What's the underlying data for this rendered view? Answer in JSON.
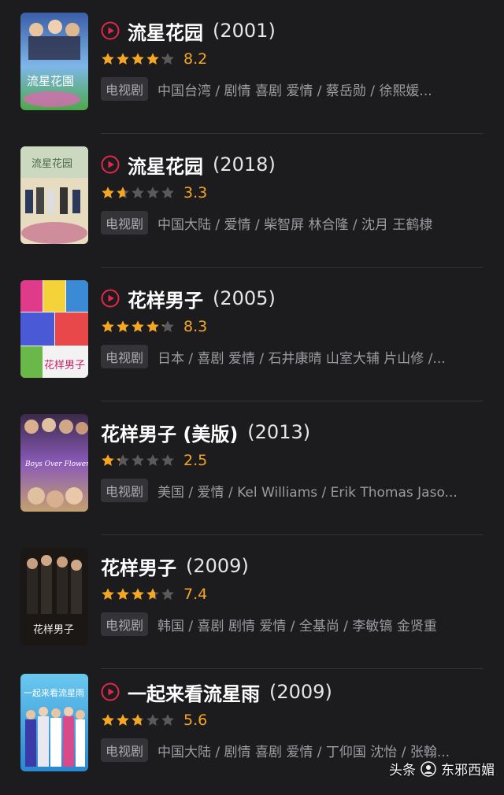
{
  "colors": {
    "accent": "#e0284a",
    "star": "#f5a623",
    "star_empty": "#5a5a5e",
    "tag_bg": "#343438"
  },
  "items": [
    {
      "title": "流星花园",
      "year": "(2001)",
      "has_play": true,
      "rating": 8.2,
      "score": "8.2",
      "tag": "电视剧",
      "meta": "中国台湾 / 剧情 喜剧 爱情 / 蔡岳勋 / 徐熙媛...",
      "poster_text": "流星花園"
    },
    {
      "title": "流星花园",
      "year": "(2018)",
      "has_play": true,
      "rating": 3.3,
      "score": "3.3",
      "tag": "电视剧",
      "meta": "中国大陆 / 爱情 / 柴智屏 林合隆 / 沈月 王鹤棣",
      "poster_text": "流星花园"
    },
    {
      "title": "花样男子",
      "year": "(2005)",
      "has_play": true,
      "rating": 8.3,
      "score": "8.3",
      "tag": "电视剧",
      "meta": "日本 / 喜剧 爱情 / 石井康晴 山室大辅 片山修 /...",
      "poster_text": "花样男子"
    },
    {
      "title": "花样男子 (美版)",
      "year": "(2013)",
      "has_play": false,
      "rating": 2.5,
      "score": "2.5",
      "tag": "电视剧",
      "meta": "美国 / 爱情 / Kel Williams / Erik Thomas Jaso...",
      "poster_text": "Boys Over Flowers"
    },
    {
      "title": "花样男子",
      "year": "(2009)",
      "has_play": false,
      "rating": 7.4,
      "score": "7.4",
      "tag": "电视剧",
      "meta": "韩国 / 喜剧 剧情 爱情 / 全基尚 / 李敏镐 金贤重",
      "poster_text": "花样男子"
    },
    {
      "title": "一起来看流星雨",
      "year": "(2009)",
      "has_play": true,
      "rating": 5.6,
      "score": "5.6",
      "tag": "电视剧",
      "meta": "中国大陆 / 剧情 喜剧 爱情 / 丁仰国 沈怡 / 张翰...",
      "poster_text": "一起来看流星雨"
    }
  ],
  "watermark": {
    "left": "头条",
    "right": "东邪西媚"
  }
}
